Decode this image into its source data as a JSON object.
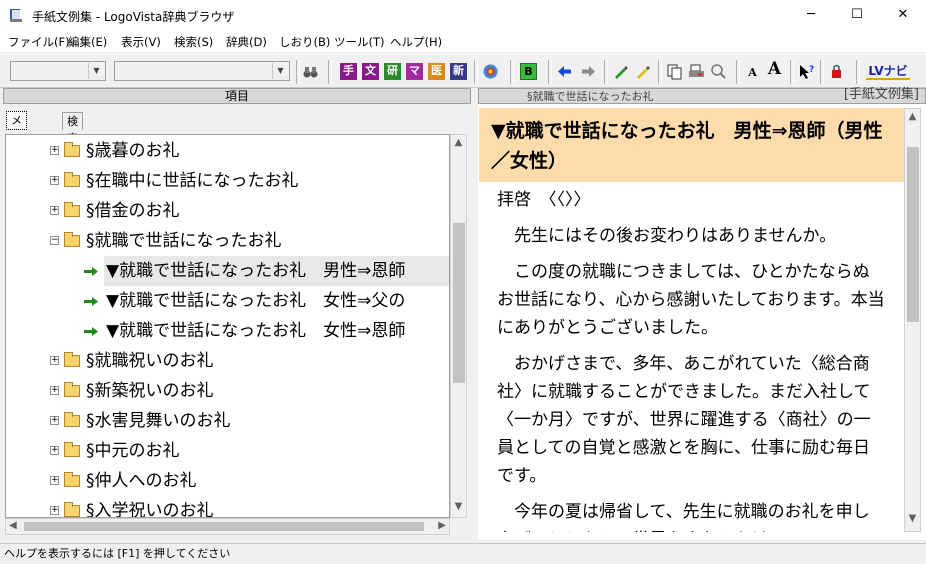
{
  "window": {
    "title": "手紙文例集 - LogoVista辞典ブラウザ",
    "minimize": "─",
    "maximize": "☐",
    "close": "✕"
  },
  "menubar": {
    "items": [
      "ファイル(F)",
      "編集(E)",
      "表示(V)",
      "検索(S)",
      "辞典(D)",
      "しおり(B)",
      "ツール(T)",
      "ヘルプ(H)"
    ]
  },
  "toolbar": {
    "dict_buttons": [
      "手",
      "文",
      "研",
      "マ",
      "医",
      "新"
    ],
    "b_button": "B",
    "font_small": "A",
    "font_large": "A",
    "lv_button": "LVナビ"
  },
  "left_pane": {
    "header": "項目",
    "tabs": [
      "メニュー",
      "検索結果"
    ],
    "tree": [
      {
        "label": "§歳暮のお礼",
        "type": "folder",
        "expander": "+"
      },
      {
        "label": "§在職中に世話になったお礼",
        "type": "folder",
        "expander": "+"
      },
      {
        "label": "§借金のお礼",
        "type": "folder",
        "expander": "+"
      },
      {
        "label": "§就職で世話になったお礼",
        "type": "folder",
        "expander": "−"
      },
      {
        "label": "▼就職で世話になったお礼　男性⇒恩師",
        "type": "entry",
        "selected": true
      },
      {
        "label": "▼就職で世話になったお礼　女性⇒父の",
        "type": "entry"
      },
      {
        "label": "▼就職で世話になったお礼　女性⇒恩師",
        "type": "entry"
      },
      {
        "label": "§就職祝いのお礼",
        "type": "folder",
        "expander": "+"
      },
      {
        "label": "§新築祝いのお礼",
        "type": "folder",
        "expander": "+"
      },
      {
        "label": "§水害見舞いのお礼",
        "type": "folder",
        "expander": "+"
      },
      {
        "label": "§中元のお礼",
        "type": "folder",
        "expander": "+"
      },
      {
        "label": "§仲人へのお礼",
        "type": "folder",
        "expander": "+"
      },
      {
        "label": "§入学祝いのお礼",
        "type": "folder",
        "expander": "+"
      }
    ]
  },
  "right_pane": {
    "breadcrumb": "§就職で世話になったお礼",
    "dict_name": "[手紙文例集]",
    "entry_title": "▼就職で世話になったお礼　男性⇒恩師（男性／女性）",
    "paragraphs": [
      "拝啓　〈〈〉〉",
      "　先生にはその後お変わりはありませんか。",
      "　この度の就職につきましては、ひとかたならぬお世話になり、心から感謝いたしております。本当にありがとうございました。",
      "　おかげさまで、多年、あこがれていた〈総合商社〉に就職することができました。まだ入社して〈一か月〉ですが、世界に躍進する〈商社〉の一員としての自覚と感激とを胸に、仕事に励む毎日です。",
      "　今年の夏は帰省して、先生に就職のお礼を申し上げるとともに、世界をまたにかける"
    ]
  },
  "statusbar": {
    "text": "ヘルプを表示するには [F1] を押してください"
  },
  "colors": {
    "entry_header_bg": "#fedbab",
    "selected_row_bg": "#e8e8e8",
    "arrow_green": "#1e8a1e"
  }
}
